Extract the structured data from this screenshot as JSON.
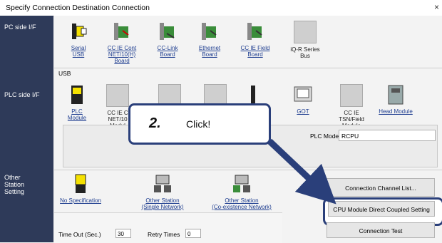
{
  "window": {
    "title": "Specify Connection Destination Connection",
    "close": "×"
  },
  "side_labels": {
    "pc": "PC side I/F",
    "plc": "PLC side I/F",
    "other": [
      "Other",
      "Station",
      "Setting"
    ]
  },
  "pc_items": [
    {
      "label": [
        "Serial",
        "USB"
      ],
      "icon": "usb-icon"
    },
    {
      "label": [
        "CC IE Cont",
        "NET/10(H)",
        "Board"
      ],
      "icon": "cc-ie-cont-board-icon"
    },
    {
      "label": [
        "CC-Link",
        "Board"
      ],
      "icon": "cc-link-board-icon"
    },
    {
      "label": [
        "Ethernet",
        "Board"
      ],
      "icon": "ethernet-board-icon"
    },
    {
      "label": [
        "CC IE Field",
        "Board"
      ],
      "icon": "cc-ie-field-board-icon"
    },
    {
      "label": [
        "iQ-R Series",
        "Bus"
      ],
      "icon": "iq-r-series-bus-icon"
    }
  ],
  "usb_label": "USB",
  "plc_items": [
    {
      "label": [
        "PLC",
        "Module"
      ],
      "icon": "plc-module-icon"
    },
    {
      "label": [
        "CC IE C",
        "NET/10",
        "Modul"
      ],
      "icon": "cc-ie-cont-module-icon"
    },
    {
      "label": [
        "GOT"
      ],
      "icon": "got-icon"
    },
    {
      "label": [
        "CC IE",
        "TSN/Field",
        "Module"
      ],
      "icon": "cc-ie-tsn-field-module-icon"
    },
    {
      "label": [
        "Head Module"
      ],
      "icon": "head-module-icon"
    }
  ],
  "plc_mode": {
    "label": "PLC Mode",
    "value": "RCPU"
  },
  "callout": {
    "number": "2.",
    "text": "Click!"
  },
  "other_items": [
    {
      "label": [
        "No Specification"
      ],
      "icon": "no-specification-icon"
    },
    {
      "label": [
        "Other Station",
        "(Single Network)"
      ],
      "icon": "other-station-single-icon"
    },
    {
      "label": [
        "Other Station",
        "(Co-existence Network)"
      ],
      "icon": "other-station-coexistence-icon"
    }
  ],
  "buttons": {
    "channel_list": "Connection Channel List...",
    "cpu_direct": "CPU Module Direct Coupled Setting",
    "connection_test": "Connection Test"
  },
  "timeout": {
    "label": "Time Out (Sec.)",
    "value": "30"
  },
  "retry": {
    "label": "Retry Times",
    "value": "0"
  },
  "colors": {
    "sidebar": "#2e3a59",
    "accent": "#2a3f7a",
    "link": "#1f3e90"
  }
}
